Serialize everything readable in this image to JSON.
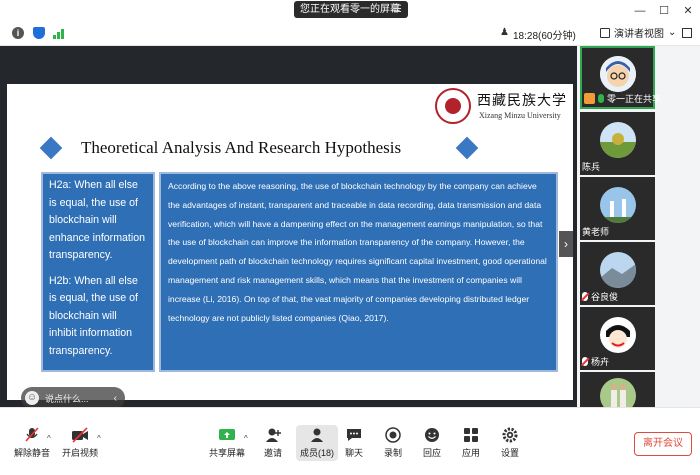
{
  "topbar": {
    "share_banner": "您正在观看零一的屏幕",
    "time_label": "18:28(60分钟)",
    "view_label": "演讲者视图"
  },
  "slide": {
    "univ_cn": "西藏民族大学",
    "univ_en": "Xizang Minzu University",
    "title": "Theoretical Analysis And  Research Hypothesis",
    "h2a": "H2a: When all else is equal, the use of blockchain will enhance information transparency.",
    "h2b": "H2b: When all else is equal, the use of blockchain will inhibit information transparency.",
    "body": "According to the above reasoning, the use of blockchain technology by the company can achieve the advantages of instant, transparent and traceable in data recording, data transmission and data verification, which will have a dampening effect on the management earnings manipulation, so that the use of blockchain can improve the information transparency of the company. However, the development path of blockchain technology requires significant capital investment, good operational management and risk management skills, which means that the investment of companies will increase (Li, 2016). On top of that, the vast majority of companies developing distributed ledger technology are not publicly listed companies (Qiao, 2017)."
  },
  "chat": {
    "placeholder": "说点什么..."
  },
  "participants": [
    {
      "name": "零一正在共享"
    },
    {
      "name": "陈兵"
    },
    {
      "name": "黄老师"
    },
    {
      "name": "谷良俊"
    },
    {
      "name": "杨卉"
    }
  ],
  "toolbar": {
    "unmute": "解除静音",
    "start_video": "开启视频",
    "share_screen": "共享屏幕",
    "invite": "邀请",
    "members": "成员(18)",
    "chat": "聊天",
    "record": "录制",
    "reactions": "回应",
    "apps": "应用",
    "settings": "设置",
    "leave": "离开会议"
  },
  "colors": {
    "slide_blue": "#2f6fb6",
    "leave_red": "#e14b3b",
    "active_green": "#2fa84f"
  }
}
